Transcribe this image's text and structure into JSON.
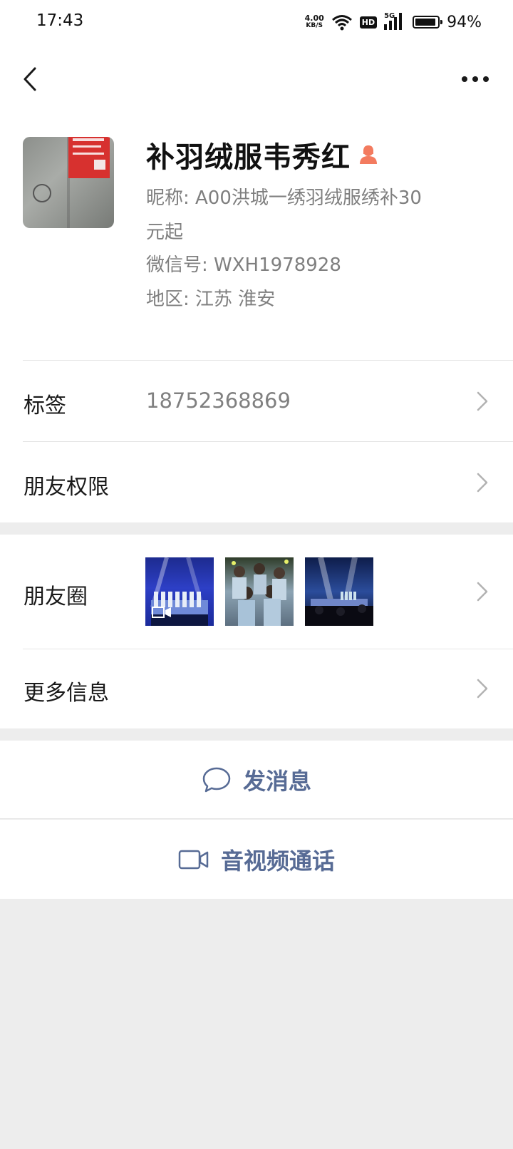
{
  "status_bar": {
    "time": "17:43",
    "net_speed_value": "4.00",
    "net_speed_unit": "KB/S",
    "hd": "HD",
    "network": "5G",
    "battery": "94%"
  },
  "nav": {
    "back_icon": "chevron-left-icon",
    "more_icon": "more-dots-icon"
  },
  "profile": {
    "display_name": "补羽绒服韦秀红",
    "gender_icon": "female-user-icon",
    "gender_color": "#f37b5f",
    "nickname_line1": "昵称:  A00洪城一绣羽绒服绣补30",
    "nickname_line2": "元起",
    "wechat_id": "微信号:  WXH1978928",
    "region": "地区:  江苏  淮安"
  },
  "rows": {
    "tag_label": "标签",
    "tag_value": "18752368869",
    "permission_label": "朋友权限",
    "moments_label": "朋友圈",
    "more_info_label": "更多信息"
  },
  "actions": {
    "send_message": "发消息",
    "video_call": "音视频通话",
    "accent_color": "#576b95"
  }
}
